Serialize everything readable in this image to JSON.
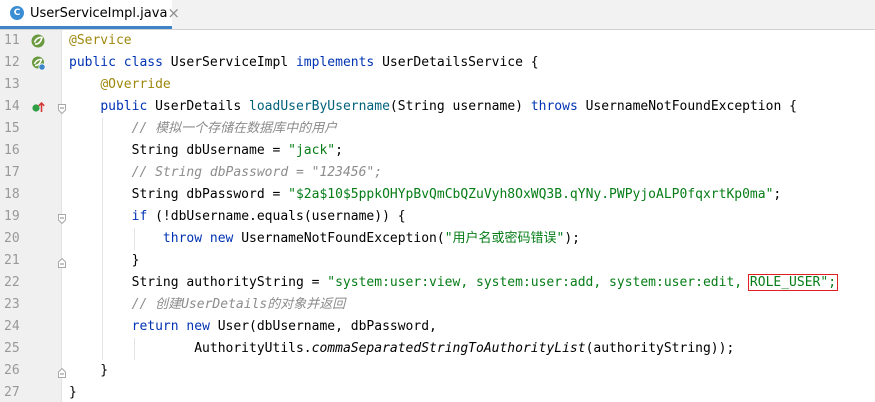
{
  "tab": {
    "icon_letter": "C",
    "filename": "UserServiceImpl.java",
    "close": "×"
  },
  "lines": [
    {
      "num": "11",
      "gutter_icon": "spring-bean-icon",
      "fold": "none",
      "tokens": [
        {
          "t": "@Service",
          "c": "ann"
        }
      ]
    },
    {
      "num": "12",
      "gutter_icon": "spring-bean-implements-icon",
      "fold": "none",
      "tokens": [
        {
          "t": "public class ",
          "c": "kw"
        },
        {
          "t": "UserServiceImpl "
        },
        {
          "t": "implements ",
          "c": "kw"
        },
        {
          "t": "UserDetailsService {"
        }
      ]
    },
    {
      "num": "13",
      "gutter_icon": "",
      "fold": "none",
      "tokens": [
        {
          "t": "    "
        },
        {
          "t": "@Override",
          "c": "ann"
        }
      ]
    },
    {
      "num": "14",
      "gutter_icon": "override-method-icon",
      "fold": "open",
      "tokens": [
        {
          "t": "    "
        },
        {
          "t": "public ",
          "c": "kw"
        },
        {
          "t": "UserDetails "
        },
        {
          "t": "loadUserByUsername",
          "c": "fn"
        },
        {
          "t": "(String username) "
        },
        {
          "t": "throws ",
          "c": "kw"
        },
        {
          "t": "UsernameNotFoundException {"
        }
      ]
    },
    {
      "num": "15",
      "gutter_icon": "",
      "fold": "none",
      "tokens": [
        {
          "t": "        "
        },
        {
          "t": "// 模拟一个存储在数据库中的用户",
          "c": "cmt"
        }
      ]
    },
    {
      "num": "16",
      "gutter_icon": "",
      "fold": "none",
      "tokens": [
        {
          "t": "        String dbUsername = "
        },
        {
          "t": "\"jack\"",
          "c": "str"
        },
        {
          "t": ";"
        }
      ]
    },
    {
      "num": "17",
      "gutter_icon": "",
      "fold": "none",
      "tokens": [
        {
          "t": "        "
        },
        {
          "t": "// String dbPassword = \"123456\";",
          "c": "cmt"
        }
      ]
    },
    {
      "num": "18",
      "gutter_icon": "",
      "fold": "none",
      "tokens": [
        {
          "t": "        String dbPassword = "
        },
        {
          "t": "\"$2a$10$5ppkOHYpBvQmCbQZuVyh8OxWQ3B.qYNy.PWPyjoALP0fqxrtKp0ma\"",
          "c": "str"
        },
        {
          "t": ";"
        }
      ]
    },
    {
      "num": "19",
      "gutter_icon": "",
      "fold": "open",
      "tokens": [
        {
          "t": "        "
        },
        {
          "t": "if ",
          "c": "kw"
        },
        {
          "t": "(!dbUsername.equals(username)) {"
        }
      ]
    },
    {
      "num": "20",
      "gutter_icon": "",
      "fold": "none",
      "tokens": [
        {
          "t": "            "
        },
        {
          "t": "throw new ",
          "c": "kw"
        },
        {
          "t": "UsernameNotFoundException("
        },
        {
          "t": "\"用户名或密码错误\"",
          "c": "str"
        },
        {
          "t": ");"
        }
      ]
    },
    {
      "num": "21",
      "gutter_icon": "",
      "fold": "close",
      "tokens": [
        {
          "t": "        }"
        }
      ]
    },
    {
      "num": "22",
      "gutter_icon": "",
      "fold": "none",
      "tokens": [
        {
          "t": "        String authorityString = "
        },
        {
          "t": "\"system:user:view, system:user:add, system:user:edit, ",
          "c": "str"
        },
        {
          "t": "ROLE_USER\";",
          "c": "str hl",
          "name": "highlighted-role-user"
        }
      ]
    },
    {
      "num": "23",
      "gutter_icon": "",
      "fold": "none",
      "tokens": [
        {
          "t": "        "
        },
        {
          "t": "// 创建UserDetails的对象并返回",
          "c": "cmt"
        }
      ]
    },
    {
      "num": "24",
      "gutter_icon": "",
      "fold": "none",
      "tokens": [
        {
          "t": "        "
        },
        {
          "t": "return new ",
          "c": "kw"
        },
        {
          "t": "User(dbUsername, dbPassword,"
        }
      ]
    },
    {
      "num": "25",
      "gutter_icon": "",
      "fold": "none",
      "tokens": [
        {
          "t": "                AuthorityUtils."
        },
        {
          "t": "commaSeparatedStringToAuthorityList",
          "c": "ital"
        },
        {
          "t": "(authorityString));"
        }
      ]
    },
    {
      "num": "26",
      "gutter_icon": "",
      "fold": "close",
      "tokens": [
        {
          "t": "    }"
        }
      ]
    },
    {
      "num": "27",
      "gutter_icon": "",
      "fold": "none",
      "tokens": [
        {
          "t": "}"
        }
      ]
    }
  ],
  "colors": {
    "keyword": "#0033b3",
    "annotation": "#9e880d",
    "string": "#067d17",
    "comment": "#8c8c8c",
    "method": "#00627a",
    "highlight_box": "#e02020",
    "tab_underline": "#4083c9"
  }
}
